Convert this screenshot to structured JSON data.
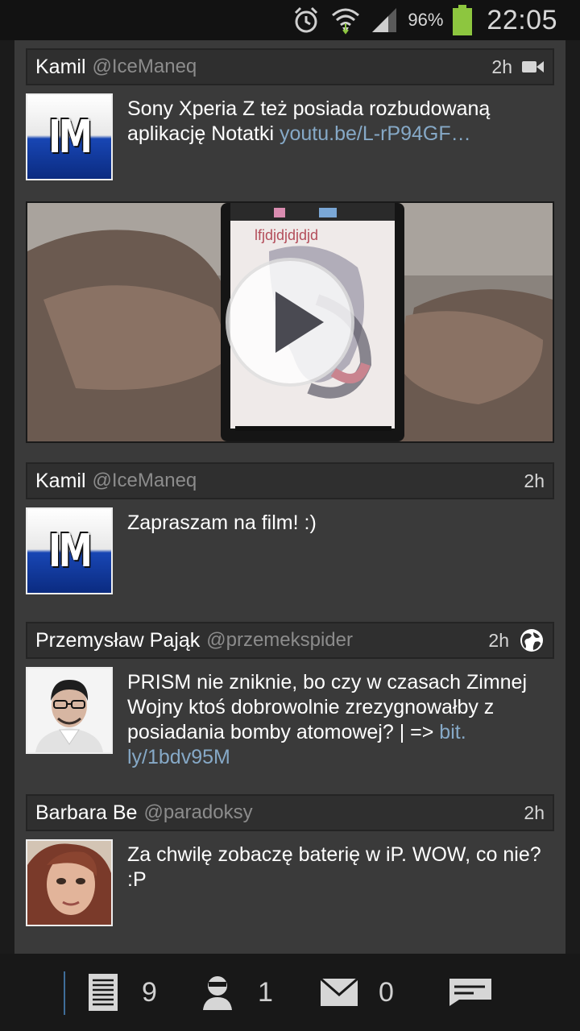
{
  "status_bar": {
    "battery_percent": "96%",
    "time": "22:05",
    "icons": [
      "alarm-icon",
      "wifi-icon",
      "signal-icon",
      "battery-icon"
    ],
    "battery_color": "#8dc63f"
  },
  "tweets": [
    {
      "author": "Kamil",
      "handle": "@IceManeq",
      "age": "2h",
      "text": "Sony Xperia Z też posiada rozbudowaną aplikację Notatki ",
      "link": "youtu.be/L-rP94GF…",
      "media_icon": "video-camera-icon",
      "avatar_text": "IM",
      "has_video": true
    },
    {
      "author": "Kamil",
      "handle": "@IceManeq",
      "age": "2h",
      "text": "Zapraszam na film! :)",
      "avatar_text": "IM"
    },
    {
      "author": "Przemysław Pająk",
      "handle": "@przemekspider",
      "age": "2h",
      "text": "PRISM nie zniknie, bo czy w czasach Zimnej Wojny ktoś dobrowolnie zrezygnowałby z posiadania bomby atomowej? | => ",
      "link": "bit.\nly/1bdv95M",
      "media_icon": "globe-icon"
    },
    {
      "author": "Barbara Be",
      "handle": "@paradoksy",
      "age": "2h",
      "text": "Za chwilę zobaczę baterię w iP. WOW, co nie? :P"
    }
  ],
  "video_preview": {
    "screen_text": "lfjdjdjdjdjd",
    "play_icon": "play-icon"
  },
  "bottom_bar": {
    "timeline_count": "9",
    "mentions_count": "1",
    "messages_count": "0",
    "icons": [
      "timeline-icon",
      "mentions-icon",
      "messages-icon",
      "compose-icon"
    ]
  },
  "colors": {
    "link": "#86a9c7",
    "feed_bg": "#3a3a3a",
    "header_bg": "#2f2f2f",
    "accent_divider": "#3f6d99"
  }
}
